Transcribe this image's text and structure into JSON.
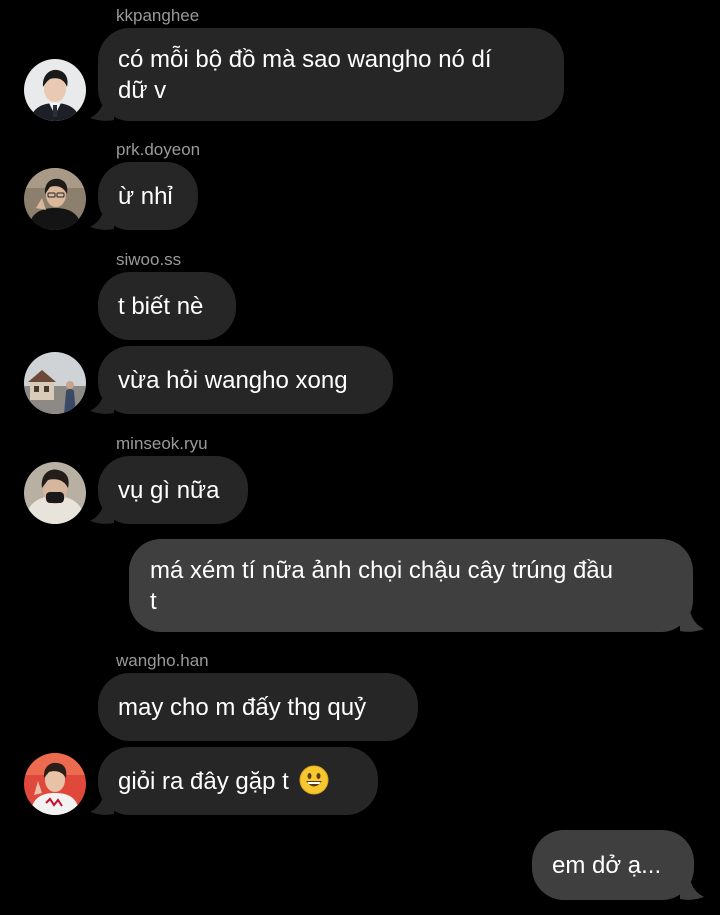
{
  "messages": [
    {
      "sender": "kkpanghee",
      "lines": [
        "có mỗi bộ đồ mà sao wangho nó dí",
        "dữ v"
      ]
    },
    {
      "sender": "prk.doyeon",
      "lines": [
        "ừ nhỉ"
      ]
    },
    {
      "sender": "siwoo.ss",
      "lines": [
        "t biết nè"
      ]
    },
    {
      "sender": "",
      "lines": [
        "vừa hỏi wangho xong"
      ]
    },
    {
      "sender": "minseok.ryu",
      "lines": [
        "vụ gì nữa"
      ]
    },
    {
      "sender": "",
      "lines": [
        "má xém tí nữa ảnh chọi chậu cây trúng đầu",
        "t"
      ],
      "outgoing": true
    },
    {
      "sender": "wangho.han",
      "lines": [
        "may cho m đấy thg quỷ"
      ]
    },
    {
      "sender": "",
      "lines": [
        "giỏi ra đây gặp t"
      ],
      "emoji": "grinning-face"
    },
    {
      "sender": "",
      "lines": [
        "em dở ạ..."
      ],
      "outgoing": true
    }
  ],
  "colors": {
    "background": "#000000",
    "incoming_bubble": "#262626",
    "outgoing_bubble": "#3f3f3f",
    "sender_text": "#9a9a9a",
    "message_text": "#ffffff"
  }
}
